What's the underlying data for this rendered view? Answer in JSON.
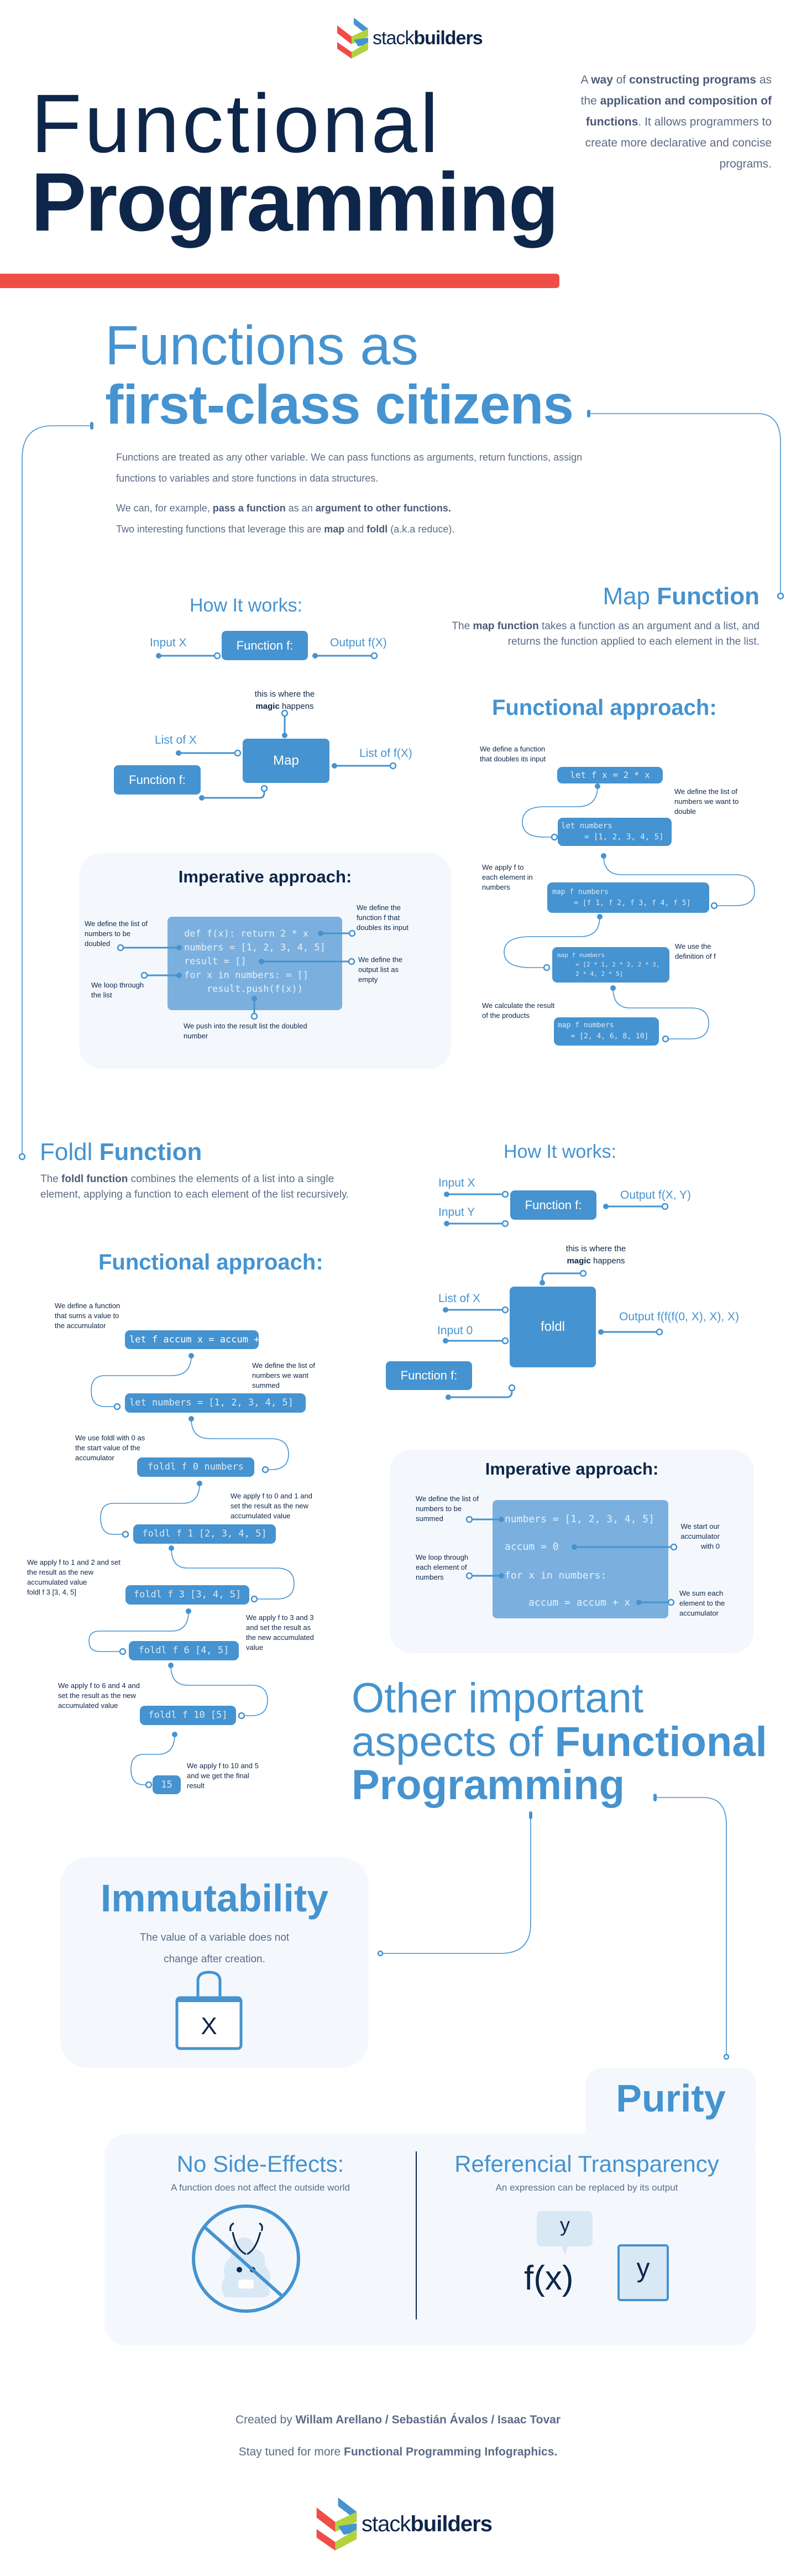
{
  "brand": {
    "name_light": "stack",
    "name_bold": "builders"
  },
  "colors": {
    "primary_blue": "#4593d0",
    "navy": "#0e2649",
    "accent_red": "#ef4e46",
    "accent_green": "#b2d23e",
    "text_gray": "#5b6b87",
    "card_bg": "#f4f8fd",
    "code_bg_light": "#7bb0de"
  },
  "hero": {
    "title_line1": "Functional",
    "title_line2": "Programming",
    "description": [
      {
        "t": "A "
      },
      {
        "t": "way",
        "b": true
      },
      {
        "t": " of "
      },
      {
        "t": "constructing programs",
        "b": true
      },
      {
        "t": " as the "
      },
      {
        "t": "application and composition of functions",
        "b": true
      },
      {
        "t": ". It allows programmers to create more declarative and concise programs."
      }
    ]
  },
  "first_class": {
    "title_line1": "Functions as",
    "title_line2": "first-class citizens",
    "paragraph1": [
      {
        "t": "Functions are treated as any other variable. We can pass functions as arguments, return functions, assign functions to variables and store functions in data structures."
      }
    ],
    "paragraph2": [
      {
        "t": "We can, for example, "
      },
      {
        "t": "pass a function",
        "b": true
      },
      {
        "t": " as an "
      },
      {
        "t": "argument to other functions.",
        "b": true
      },
      {
        "t": "\nTwo interesting functions that leverage this are "
      },
      {
        "t": "map",
        "b": true
      },
      {
        "t": " and "
      },
      {
        "t": "foldl",
        "b": true
      },
      {
        "t": " (a.k.a reduce)."
      }
    ]
  },
  "map_how": {
    "title": "How It works:",
    "input_x": "Input X",
    "function_label": "Function f:",
    "output": "Output f(X)",
    "magic_line1": "this is where the",
    "magic_bold": "magic",
    "magic_rest": " happens",
    "list_x": "List of X",
    "box": "Map",
    "list_fx": "List of f(X)",
    "function_label2": "Function f:"
  },
  "map_imperative": {
    "title": "Imperative approach:",
    "code": [
      "def f(x): return 2 * x",
      "numbers = [1, 2, 3, 4, 5]",
      "result = []",
      "for x in numbers: = []",
      "    result.push(f(x))"
    ],
    "notes": {
      "numbers": "We define the list of\nnumbers to be\ndoubled",
      "function": "We define the\nfunction f that\ndoubles its input",
      "result": "We define the\noutput list as\nempty",
      "loop": "We loop through\nthe list",
      "push": "We push into the result list the doubled\nnumber"
    }
  },
  "map_function": {
    "title_light": "Map",
    "title_bold": "Function",
    "description": [
      {
        "t": "The "
      },
      {
        "t": "map function",
        "b": true
      },
      {
        "t": " takes a function as an argument and a list, and returns the function applied to each element in the list."
      }
    ],
    "functional_title": "Functional approach:",
    "steps": [
      {
        "code": "let f x = 2 * x",
        "note": "We define a function\nthat doubles its input"
      },
      {
        "code": "let numbers\n     = [1, 2, 3, 4, 5]",
        "note": "We define the list of\nnumbers we want to\ndouble"
      },
      {
        "code": "map f numbers\n     = [f 1, f 2, f 3, f 4, f 5]",
        "note": "We apply f to\neach element in\nnumbers"
      },
      {
        "code": "map f numbers\n     = [2 * 1, 2 * 2, 2 * 3,\n     2 * 4, 2 * 5]",
        "note": "We use the\ndefinition of f"
      },
      {
        "code": "map f numbers\n   = [2, 4, 6, 8, 10]",
        "note": "We calculate the result\nof the products"
      }
    ]
  },
  "foldl_function": {
    "title_light": "Foldl",
    "title_bold": "Function",
    "description": [
      {
        "t": "The "
      },
      {
        "t": "foldl function",
        "b": true
      },
      {
        "t": " combines the elements of a list into a single element, applying a function to each element of the list recursively."
      }
    ],
    "functional_title": "Functional approach:",
    "steps": [
      {
        "code": "let f accum x = accum + x",
        "note": "We define a function\nthat sums a value to\nthe accumulator"
      },
      {
        "code": "let numbers = [1, 2, 3, 4, 5]",
        "note": "We define the list of\nnumbers we want\nsummed"
      },
      {
        "code": "foldl f 0 numbers",
        "note": "We use foldl with 0 as\nthe start value of the\naccumulator"
      },
      {
        "code": "foldl f 1 [2, 3, 4, 5]",
        "note": "We apply f to 0 and 1 and\nset the result as the new\naccumulated value"
      },
      {
        "code": "foldl f 3 [3, 4, 5]",
        "note": "We apply f to 1 and 2 and set\nthe result as the new\naccumulated value\nfoldl f 3 [3, 4, 5]"
      },
      {
        "code": "foldl f 6 [4, 5]",
        "note": "We apply f to 3 and 3\nand set the result as\nthe new accumulated\nvalue"
      },
      {
        "code": "foldl f 10 [5]",
        "note": "We apply f to 6 and 4 and\nset the result as the new\naccumulated value"
      },
      {
        "code": "15",
        "note": "We apply f to 10 and 5\nand we get the final\nresult"
      }
    ]
  },
  "foldl_how": {
    "title": "How It works:",
    "input_x": "Input X",
    "input_y": "Input Y",
    "function_label": "Function f:",
    "output": "Output f(X, Y)",
    "magic_line1": "this is where the",
    "magic_bold": "magic",
    "magic_rest": " happens",
    "list_x": "List of X",
    "input_0": "Input 0",
    "box": "foldl",
    "output2": "Output f(f(f(0, X), X), X)",
    "function_label2": "Function f:"
  },
  "foldl_imperative": {
    "title": "Imperative approach:",
    "code": [
      "numbers = [1, 2, 3, 4, 5]",
      "accum = 0",
      "for x in numbers:",
      "accum = accum + x"
    ],
    "notes": {
      "numbers": "We define the list of\nnumbers to be\nsummed",
      "accum": "We start our\naccumulator\nwith 0",
      "loop": "We loop through\neach element of\nnumbers",
      "sum": "We sum each\nelement to the\naccumulator"
    }
  },
  "other_aspects": {
    "title_line1": "Other important",
    "title_line2_light": "aspects of ",
    "title_line2_bold": "Functional",
    "title_line3_bold": "Programming"
  },
  "immutability": {
    "title": "Immutability",
    "description": "The value of a variable does not\nchange after creation.",
    "lock_variable": "X",
    "icon": "lock-icon"
  },
  "purity": {
    "title": "Purity",
    "no_side_effects": {
      "title": "No Side-Effects:",
      "description": "A function does not affect the outside world",
      "icon": "no-side-effects-icon"
    },
    "referential_transparency": {
      "title": "Referencial Transparency",
      "description": "An expression can be replaced by its output",
      "bubble": "y",
      "expression": "f(x)",
      "output": "y"
    }
  },
  "footer": {
    "created_by": "Created by ",
    "authors": "Willam Arellano / Sebastián Ávalos / Isaac Tovar",
    "stay_tuned": "Stay tuned for more ",
    "stay_tuned_bold": "Functional Programming Infographics."
  }
}
